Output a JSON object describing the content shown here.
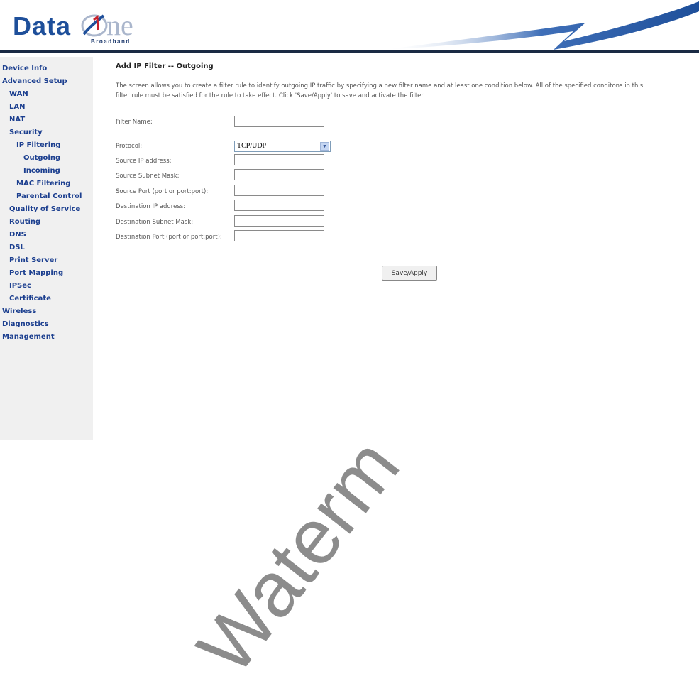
{
  "brand": {
    "name_part1": "Data",
    "name_part2": "ne",
    "tagline": "Broadband"
  },
  "sidebar": {
    "items": [
      {
        "label": "Device Info"
      },
      {
        "label": "Advanced Setup"
      },
      {
        "label": "WAN"
      },
      {
        "label": "LAN"
      },
      {
        "label": "NAT"
      },
      {
        "label": "Security"
      },
      {
        "label": "IP Filtering"
      },
      {
        "label": "Outgoing"
      },
      {
        "label": "Incoming"
      },
      {
        "label": "MAC Filtering"
      },
      {
        "label": "Parental Control"
      },
      {
        "label": "Quality of Service"
      },
      {
        "label": "Routing"
      },
      {
        "label": "DNS"
      },
      {
        "label": "DSL"
      },
      {
        "label": "Print Server"
      },
      {
        "label": "Port Mapping"
      },
      {
        "label": "IPSec"
      },
      {
        "label": "Certificate"
      },
      {
        "label": "Wireless"
      },
      {
        "label": "Diagnostics"
      },
      {
        "label": "Management"
      }
    ]
  },
  "page": {
    "title": "Add IP Filter -- Outgoing",
    "description_line1": "The screen allows you to create a filter rule to identify outgoing IP traffic by specifying a new filter name and at least one condition below. All of the specified conditons in this",
    "description_line2": "filter rule must be satisfied for the rule to take effect. Click 'Save/Apply' to save and activate the filter."
  },
  "form": {
    "filter_name_label": "Filter Name:",
    "filter_name_value": "",
    "protocol_label": "Protocol:",
    "protocol_value": "TCP/UDP",
    "source_ip_label": "Source IP address:",
    "source_mask_label": "Source Subnet Mask:",
    "source_port_label": "Source Port (port or port:port):",
    "dest_ip_label": "Destination IP address:",
    "dest_mask_label": "Destination Subnet Mask:",
    "dest_port_label": "Destination Port (port or port:port):",
    "save_label": "Save/Apply"
  },
  "watermark": {
    "text": "Waterm"
  },
  "colors": {
    "nav_link": "#1c3f8f",
    "sidebar_bg": "#f0f0f0",
    "header_rule": "#1a2a44",
    "brand_blue": "#1e4f9a"
  }
}
